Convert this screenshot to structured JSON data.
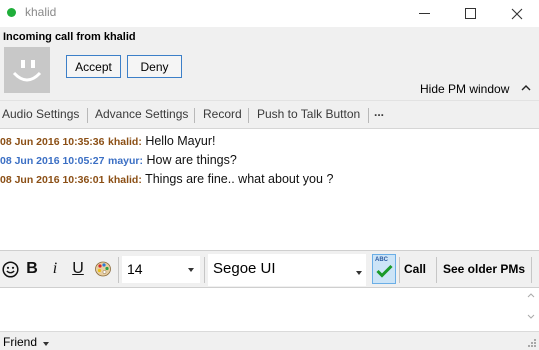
{
  "window": {
    "title": "khalid",
    "status_color": "#1fae3a"
  },
  "call": {
    "incoming_label": "Incoming call from khalid",
    "accept_label": "Accept",
    "deny_label": "Deny",
    "hide_pm_label": "Hide PM window"
  },
  "settings_bar": {
    "items": [
      "Audio Settings",
      "Advance Settings",
      "Record",
      "Push to Talk Button",
      "..."
    ]
  },
  "messages": [
    {
      "timestamp": "08 Jun 2016 10:35:36",
      "sender": "khalid",
      "text": "Hello Mayur!"
    },
    {
      "timestamp": "08 Jun 2016 10:05:27",
      "sender": "mayur",
      "text": "How are things?"
    },
    {
      "timestamp": "08 Jun 2016 10:36:01",
      "sender": "khalid",
      "text": "Things are fine.. what about you ?"
    }
  ],
  "format_bar": {
    "font_size": "14",
    "font_name": "Segoe UI",
    "call_label": "Call",
    "older_pms_label": "See older PMs",
    "icons": [
      "smiley-icon",
      "bold-icon",
      "italic-icon",
      "underline-icon",
      "color-palette-icon",
      "spellcheck-icon"
    ]
  },
  "footer": {
    "friend_label": "Friend"
  },
  "colors": {
    "khalid_name": "#8b4f15",
    "mayur_name": "#3b6fc4",
    "accent_border": "#3c7fc8"
  }
}
